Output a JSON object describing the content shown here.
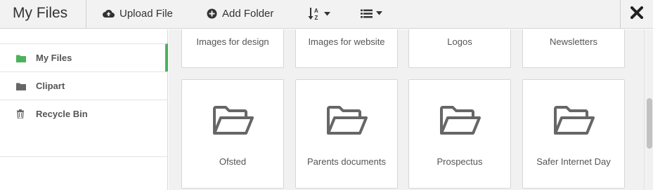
{
  "header": {
    "title": "My Files",
    "upload_label": "Upload File",
    "add_folder_label": "Add Folder",
    "sort_icon": "sort-alpha-icon",
    "view_icon": "list-view-icon",
    "close_icon": "close-icon"
  },
  "sidebar": {
    "items": [
      {
        "label": "My Files",
        "icon": "folder-icon",
        "active": true,
        "icon_color": "#4cb25a"
      },
      {
        "label": "Clipart",
        "icon": "folder-icon",
        "active": false,
        "icon_color": "#666666"
      },
      {
        "label": "Recycle Bin",
        "icon": "trash-icon",
        "active": false,
        "icon_color": "#666666"
      }
    ]
  },
  "folders": [
    {
      "name": "Images for design"
    },
    {
      "name": "Images for website"
    },
    {
      "name": "Logos"
    },
    {
      "name": "Newsletters"
    },
    {
      "name": "Ofsted"
    },
    {
      "name": "Parents documents"
    },
    {
      "name": "Prospectus"
    },
    {
      "name": "Safer Internet Day"
    }
  ],
  "colors": {
    "accent": "#4cb25a",
    "icon_gray": "#666666"
  }
}
